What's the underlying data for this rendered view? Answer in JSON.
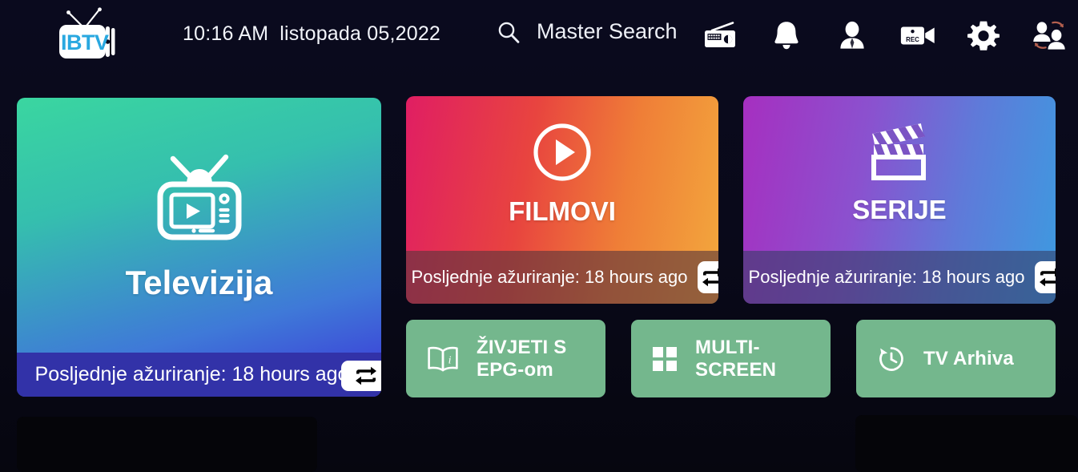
{
  "header": {
    "logo_text": "IBTV",
    "logo_icon": "tv-antenna-logo",
    "time": "10:16 AM",
    "date": "listopada 05,2022",
    "search": {
      "icon": "search-icon",
      "label": "Master Search"
    },
    "icons": [
      {
        "name": "radio-icon",
        "label": "Radio"
      },
      {
        "name": "bell-icon",
        "label": "Notifications"
      },
      {
        "name": "user-icon",
        "label": "Profile"
      },
      {
        "name": "rec-camera-icon",
        "label": "REC",
        "badge_text": "REC"
      },
      {
        "name": "gear-icon",
        "label": "Settings"
      },
      {
        "name": "switch-user-icon",
        "label": "Switch User"
      }
    ]
  },
  "cards": [
    {
      "id": "televizija",
      "title": "Televizija",
      "icon": "retro-tv-play-icon",
      "footer_text": "Posljednje ažuriranje: 18 hours ago",
      "refresh_icon": "repeat-sync-icon",
      "gradient_from": "#3ad6a0",
      "gradient_to": "#3b33d8"
    },
    {
      "id": "filmovi",
      "title": "FILMOVI",
      "icon": "play-circle-icon",
      "footer_text": "Posljednje ažuriranje: 18 hours ago",
      "refresh_icon": "repeat-sync-icon",
      "gradient_from": "#e01e63",
      "gradient_to": "#f3a83d"
    },
    {
      "id": "serije",
      "title": "SERIJE",
      "icon": "clapperboard-icon",
      "footer_text": "Posljednje ažuriranje: 18 hours ago",
      "refresh_icon": "repeat-sync-icon",
      "gradient_from": "#a62fc0",
      "gradient_to": "#3d9ae0"
    }
  ],
  "actions": [
    {
      "id": "epg",
      "label": "ŽIVJETI S EPG-om",
      "icon": "book-info-icon"
    },
    {
      "id": "multi",
      "label": "MULTI-SCREEN",
      "icon": "grid-squares-icon"
    },
    {
      "id": "arhiva",
      "label": "TV Arhiva",
      "icon": "history-clock-icon"
    }
  ],
  "theme": {
    "background": "#0a0a1e",
    "action_button": "#74b78d",
    "logo_accent": "#29a8e0",
    "text": "#ffffff"
  }
}
